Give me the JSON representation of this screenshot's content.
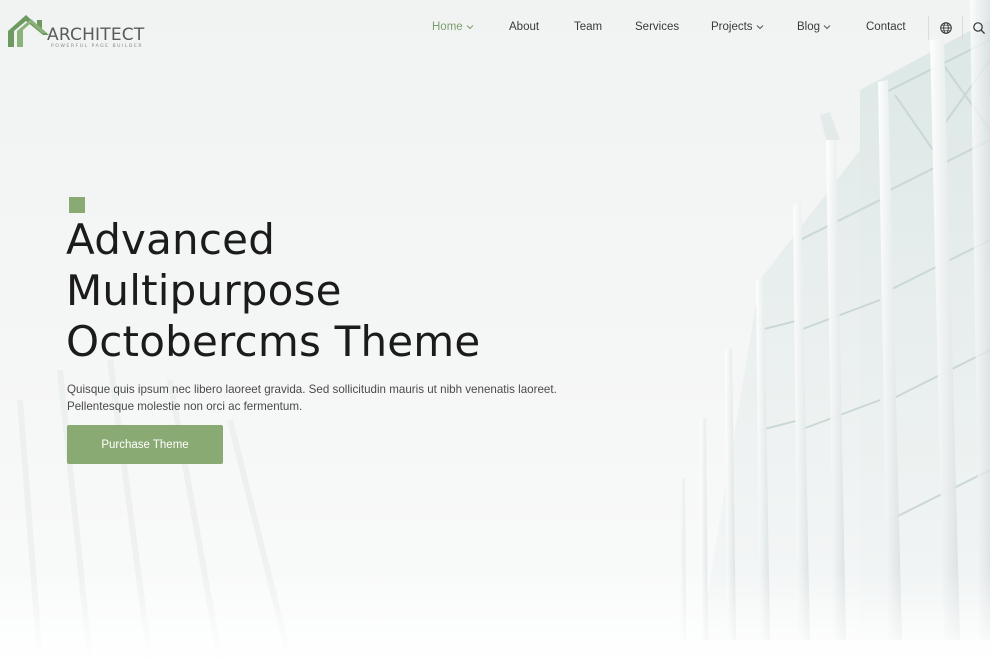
{
  "brand": {
    "name": "ARCHITECT",
    "tagline": "POWERFUL PAGE BUILDER"
  },
  "nav": {
    "items": [
      {
        "label": "Home",
        "active": true,
        "has_dropdown": true
      },
      {
        "label": "About",
        "active": false,
        "has_dropdown": false
      },
      {
        "label": "Team",
        "active": false,
        "has_dropdown": false
      },
      {
        "label": "Services",
        "active": false,
        "has_dropdown": false
      },
      {
        "label": "Projects",
        "active": false,
        "has_dropdown": true
      },
      {
        "label": "Blog",
        "active": false,
        "has_dropdown": true
      },
      {
        "label": "Contact",
        "active": false,
        "has_dropdown": false
      }
    ],
    "icons": [
      "globe-icon",
      "search-icon"
    ]
  },
  "hero": {
    "headline_lines": [
      "Advanced",
      "Multipurpose",
      "Octobercms Theme"
    ],
    "description": "Quisque quis ipsum nec libero laoreet gravida. Sed sollicitudin mauris ut nibh venenatis laoreet. Pellentesque molestie non orci ac fermentum.",
    "cta_label": "Purchase Theme"
  },
  "colors": {
    "accent": "#8aaa74",
    "active_nav": "#7c9e6e",
    "text": "#1b1b1b"
  }
}
